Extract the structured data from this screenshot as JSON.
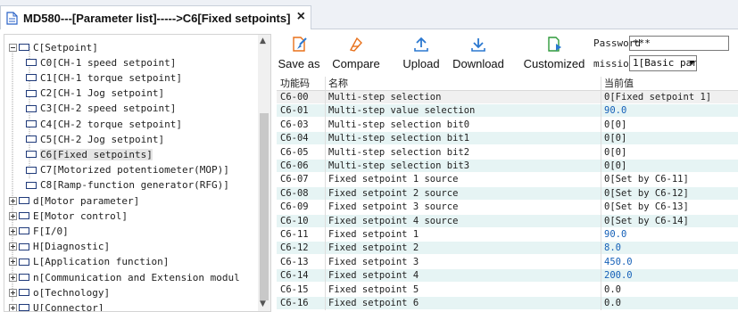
{
  "tab": {
    "title": "MD580---[Parameter list]----->C6[Fixed setpoints]",
    "close": "×"
  },
  "tree": {
    "items": [
      {
        "label": "C[Setpoint]",
        "expander": "minus",
        "indent": 0
      },
      {
        "label": "C0[CH-1 speed setpoint]",
        "expander": "",
        "indent": 1
      },
      {
        "label": "C1[CH-1 torque setpoint]",
        "expander": "",
        "indent": 1
      },
      {
        "label": "C2[CH-1 Jog setpoint]",
        "expander": "",
        "indent": 1
      },
      {
        "label": "C3[CH-2 speed setpoint]",
        "expander": "",
        "indent": 1
      },
      {
        "label": "C4[CH-2 torque setpoint]",
        "expander": "",
        "indent": 1
      },
      {
        "label": "C5[CH-2 Jog setpoint]",
        "expander": "",
        "indent": 1
      },
      {
        "label": "C6[Fixed setpoints]",
        "expander": "",
        "indent": 1,
        "selected": true
      },
      {
        "label": "C7[Motorized potentiometer(MOP)]",
        "expander": "",
        "indent": 1
      },
      {
        "label": "C8[Ramp-function generator(RFG)]",
        "expander": "",
        "indent": 1
      },
      {
        "label": "d[Motor parameter]",
        "expander": "plus",
        "indent": 0
      },
      {
        "label": "E[Motor control]",
        "expander": "plus",
        "indent": 0
      },
      {
        "label": "F[I/0]",
        "expander": "plus",
        "indent": 0
      },
      {
        "label": "H[Diagnostic]",
        "expander": "plus",
        "indent": 0
      },
      {
        "label": "L[Application function]",
        "expander": "plus",
        "indent": 0
      },
      {
        "label": "n[Communication and Extension modul",
        "expander": "plus",
        "indent": 0
      },
      {
        "label": "o[Technology]",
        "expander": "plus",
        "indent": 0
      },
      {
        "label": "U[Connector]",
        "expander": "plus",
        "indent": 0
      }
    ],
    "scroll_up": "▲",
    "scroll_down": "▼"
  },
  "toolbar": {
    "save_as": "Save as",
    "compare": "Compare",
    "upload": "Upload",
    "download": "Download",
    "customized": "Customized",
    "password_label": "Password",
    "password_value": "***",
    "permissions_label": "missions",
    "permissions_value": "1[Basic par",
    "caret": "▼"
  },
  "table": {
    "headers": {
      "code": "功能码",
      "name": "名称",
      "value": "当前值"
    },
    "rows": [
      {
        "code": "C6-00",
        "name": "Multi-step selection",
        "value": "0[Fixed setpoint 1]",
        "blue": false
      },
      {
        "code": "C6-01",
        "name": "Multi-step value selection",
        "value": "90.0",
        "blue": true
      },
      {
        "code": "C6-03",
        "name": "Multi-step selection bit0",
        "value": "0[0]",
        "blue": false
      },
      {
        "code": "C6-04",
        "name": "Multi-step selection bit1",
        "value": "0[0]",
        "blue": false
      },
      {
        "code": "C6-05",
        "name": "Multi-step selection bit2",
        "value": "0[0]",
        "blue": false
      },
      {
        "code": "C6-06",
        "name": "Multi-step selection bit3",
        "value": "0[0]",
        "blue": false
      },
      {
        "code": "C6-07",
        "name": "Fixed setpoint 1 source",
        "value": "0[Set by C6-11]",
        "blue": false
      },
      {
        "code": "C6-08",
        "name": "Fixed setpoint 2 source",
        "value": "0[Set by C6-12]",
        "blue": false
      },
      {
        "code": "C6-09",
        "name": "Fixed setpoint 3 source",
        "value": "0[Set by C6-13]",
        "blue": false
      },
      {
        "code": "C6-10",
        "name": "Fixed setpoint 4 source",
        "value": "0[Set by C6-14]",
        "blue": false
      },
      {
        "code": "C6-11",
        "name": "Fixed setpoint 1",
        "value": "90.0",
        "blue": true
      },
      {
        "code": "C6-12",
        "name": "Fixed setpoint 2",
        "value": "8.0",
        "blue": true
      },
      {
        "code": "C6-13",
        "name": "Fixed setpoint 3",
        "value": "450.0",
        "blue": true
      },
      {
        "code": "C6-14",
        "name": "Fixed setpoint 4",
        "value": "200.0",
        "blue": true
      },
      {
        "code": "C6-15",
        "name": "Fixed setpoint 5",
        "value": "0.0",
        "blue": false
      },
      {
        "code": "C6-16",
        "name": "Fixed setpoint 6",
        "value": "0.0",
        "blue": false
      }
    ]
  },
  "colors": {
    "accent_blue": "#1560b8",
    "alt_row": "#e6f4f4",
    "icon_orange": "#e8701a",
    "icon_blue": "#2b78d0",
    "icon_green": "#2e9a3a"
  }
}
